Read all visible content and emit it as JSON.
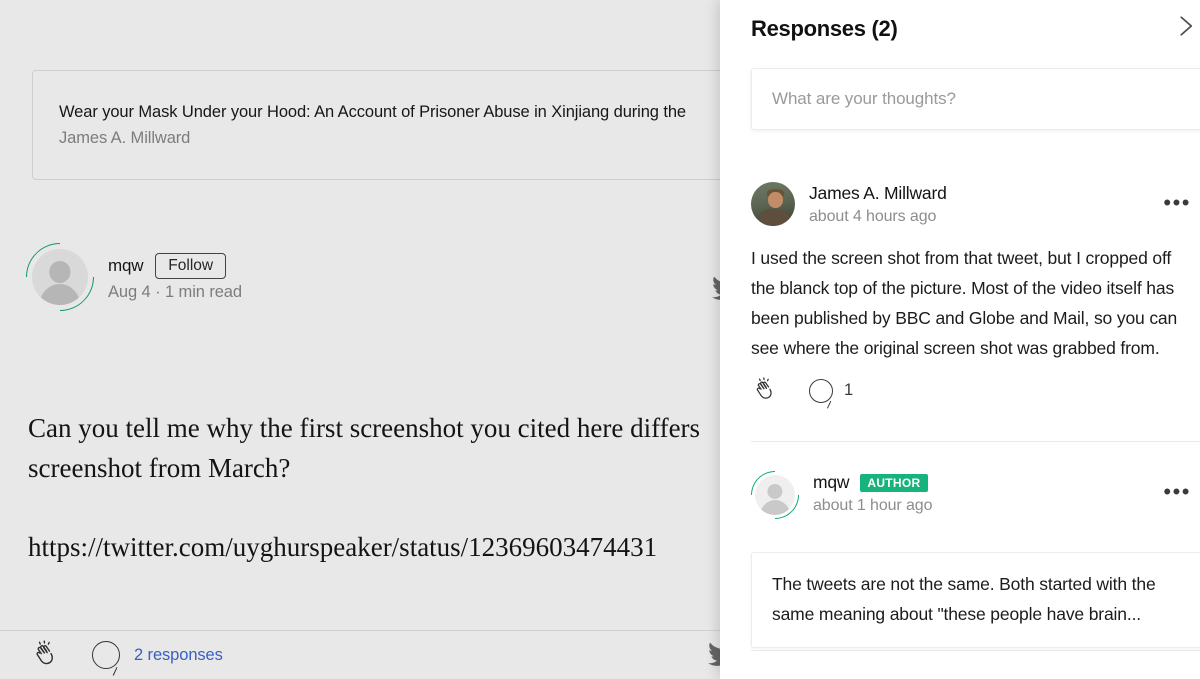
{
  "article": {
    "embed_card": {
      "title": "Wear your Mask Under your Hood: An Account of Prisoner Abuse in Xinjiang during the",
      "author": "James A. Millward"
    },
    "byline": {
      "author_name": "mqw",
      "follow_label": "Follow",
      "meta": "Aug 4 · 1 min read"
    },
    "body": {
      "paragraph": "Can you tell me why the first screenshot you cited here differs\nscreenshot from March?",
      "link": "https://twitter.com/uyghurspeaker/status/12369603474431"
    },
    "footer": {
      "responses_label": "2 responses",
      "clap_icon": "clap-icon",
      "comment_icon": "comment-bubble-icon",
      "share_icon": "twitter-bird-icon"
    }
  },
  "panel": {
    "title": "Responses (2)",
    "close_icon": "chevron-right-icon",
    "reply": {
      "placeholder": "What are your thoughts?",
      "value": ""
    },
    "responses": [
      {
        "author": "James A. Millward",
        "timestamp": "about 4 hours ago",
        "avatar": "photo-avatar",
        "badge": null,
        "text": "I used the screen shot from that tweet, but I cropped off\nthe blanck top of the picture. Most of the video itself has\nbeen published by BBC and Globe and Mail, so you can\nsee where the original screen shot was grabbed from.",
        "clap_icon": "clap-icon",
        "comment_icon": "comment-bubble-icon",
        "comment_count": "1",
        "overflow_icon": "more-horizontal-icon",
        "overflow_label": "•••"
      },
      {
        "author": "mqw",
        "timestamp": "about 1 hour ago",
        "avatar": "default-avatar",
        "badge": "AUTHOR",
        "quote": "The tweets are not the same. Both started with the\nsame meaning about \"these people have brain...",
        "overflow_icon": "more-horizontal-icon",
        "overflow_label": "•••"
      }
    ]
  },
  "colors": {
    "accent_green": "#17b37c",
    "link_blue": "#3f6ad8",
    "panel_bg": "#ffffff",
    "text_primary": "#1a1a1a",
    "text_muted": "#8a8a8a"
  }
}
